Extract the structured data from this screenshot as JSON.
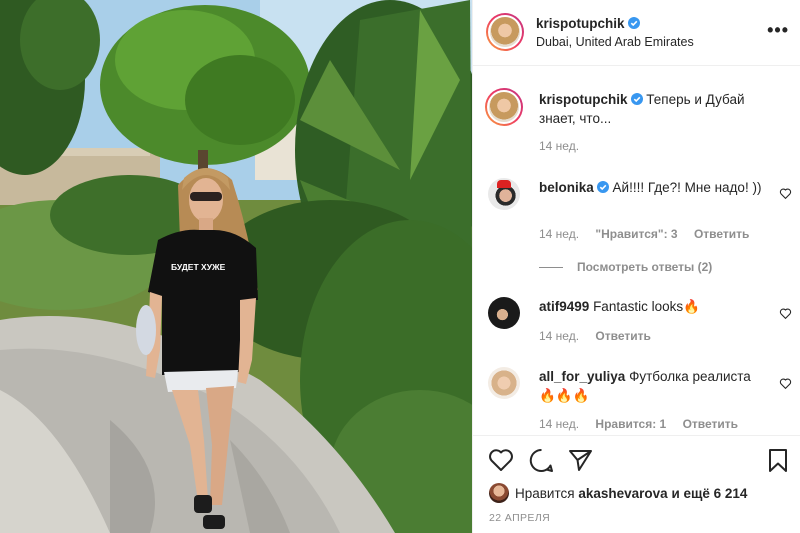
{
  "post": {
    "username": "krispotupchik",
    "location": "Dubai, United Arab Emirates",
    "more_label": "•••",
    "shirt_text": "БУДЕТ ХУЖЕ"
  },
  "caption": {
    "username": "krispotupchik",
    "text": "Теперь и Дубай знает, что...",
    "time": "14 нед."
  },
  "comments": [
    {
      "username": "belonika",
      "verified": true,
      "text": "Ай!!!! Где?! Мне надо! ))",
      "time": "14 нед.",
      "likes": "\"Нравится\": 3",
      "reply": "Ответить"
    },
    {
      "username": "atif9499",
      "verified": false,
      "text": "Fantastic looks🔥",
      "time": "14 нед.",
      "likes": "",
      "reply": "Ответить"
    },
    {
      "username": "all_for_yuliya",
      "verified": false,
      "text": "Футболка реалиста 🔥🔥🔥",
      "time": "14 нед.",
      "likes": "Нравится: 1",
      "reply": "Ответить"
    }
  ],
  "replies_label": "Посмотреть ответы (2)",
  "likes": {
    "prefix": "Нравится",
    "user": "akashevarova",
    "suffix": "и ещё 6 214"
  },
  "date": "22 АПРЕЛЯ",
  "colors": {
    "verified": "#3897f0",
    "text": "#262626",
    "muted": "#8e8e8e",
    "border": "#efefef"
  }
}
